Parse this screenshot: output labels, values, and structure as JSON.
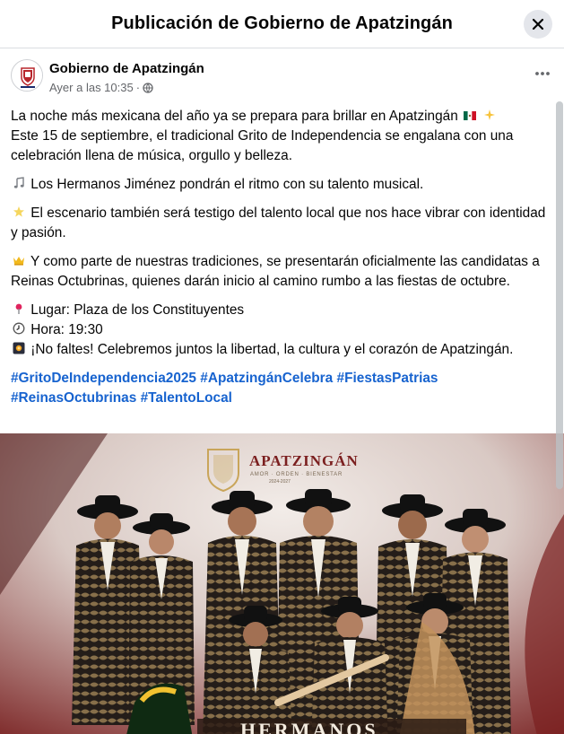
{
  "modal": {
    "title": "Publicación de Gobierno de Apatzingán"
  },
  "post": {
    "author": "Gobierno de Apatzingán",
    "timestamp": "Ayer a las 10:35",
    "separator": "·",
    "paragraphs": {
      "p1_line1": "La noche más mexicana del año ya se prepara para brillar en Apatzingán",
      "p1_line2": "Este 15 de septiembre, el tradicional Grito de Independencia se engalana con una celebración llena de música, orgullo y belleza.",
      "p2": "Los Hermanos Jiménez pondrán el ritmo con su talento musical.",
      "p3": "El escenario también será testigo del talento local que nos hace vibrar con identidad y pasión.",
      "p4": "Y como parte de nuestras tradiciones, se presentarán oficialmente las candidatas a Reinas Octubrinas, quienes darán inicio al camino rumbo a las fiestas de octubre.",
      "place": "Lugar: Plaza de los Constituyentes",
      "time": "Hora: 19:30",
      "closing": "¡No faltes! Celebremos juntos la libertad, la cultura y el corazón de Apatzingán."
    },
    "hashtags": [
      "#GritoDeIndependencia2025",
      "#ApatzingánCelebra",
      "#FiestasPatrias",
      "#ReinasOctubrinas",
      "#TalentoLocal"
    ]
  },
  "image": {
    "logo_title": "APATZINGÁN",
    "logo_subtitle": "AMOR · ORDEN · BIENESTAR",
    "logo_years": "2024-2027",
    "band_name_partial": "HERMANOS"
  },
  "colors": {
    "hashtag": "#1763cf",
    "muted": "#65676b",
    "brand_red": "#b8262c",
    "gold": "#c9a55a"
  },
  "icons": [
    "close-icon",
    "more-icon",
    "globe-icon",
    "mexico-flag-icon",
    "sparkles-icon",
    "music-notes-icon",
    "star-icon",
    "crown-icon",
    "pin-icon",
    "clock-icon",
    "fireworks-icon"
  ]
}
